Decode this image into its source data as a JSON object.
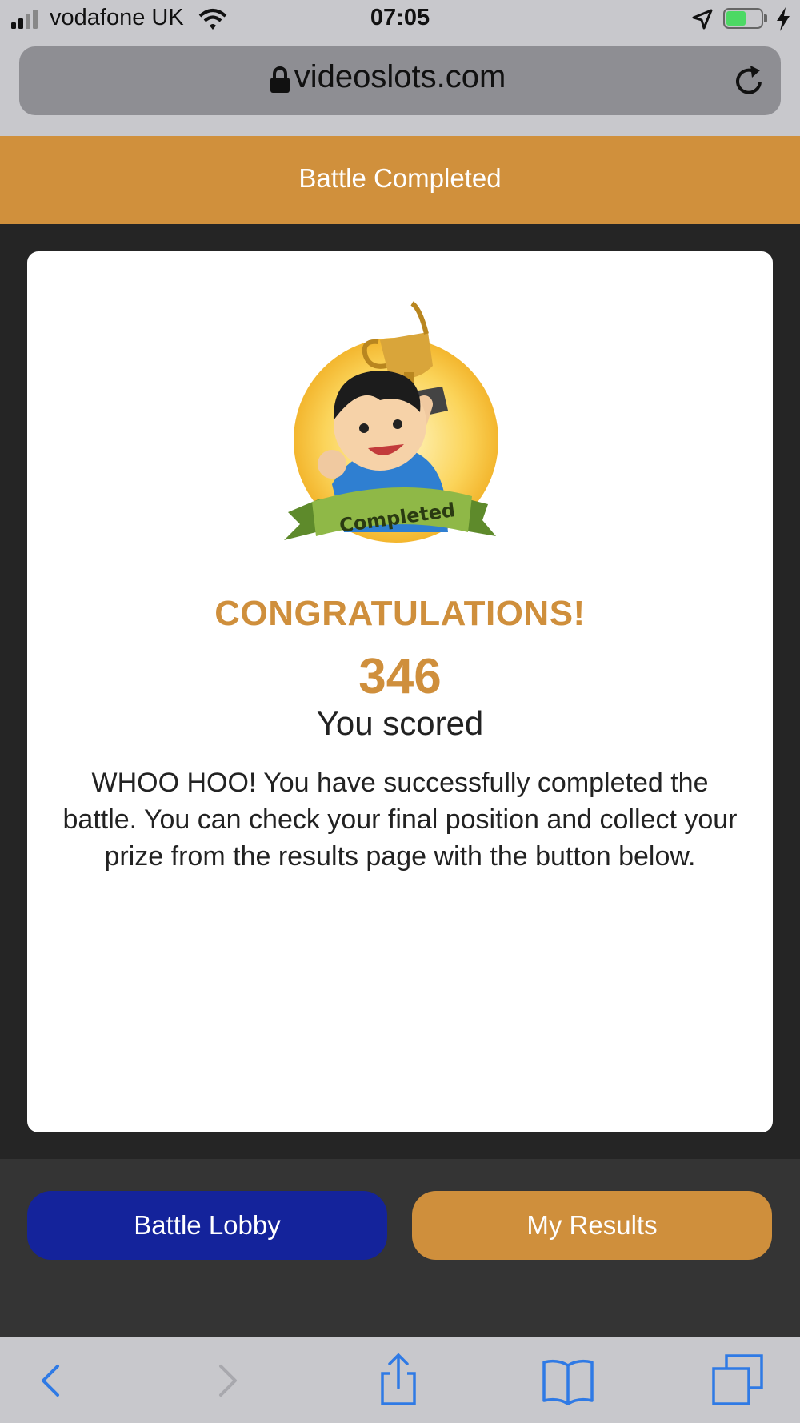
{
  "status_bar": {
    "carrier": "vodafone UK",
    "time": "07:05",
    "icons": [
      "signal-icon",
      "wifi-icon",
      "location-arrow-icon",
      "battery-icon",
      "charging-bolt-icon"
    ],
    "battery_color": "#4cd964"
  },
  "browser": {
    "url": "videoslots.com",
    "icons": [
      "lock-icon",
      "reload-icon"
    ]
  },
  "header": {
    "title": "Battle Completed"
  },
  "result": {
    "badge_text": "Completed",
    "heading": "CONGRATULATIONS!",
    "score": "346",
    "score_label": "You scored",
    "message": "WHOO HOO! You have successfully completed the battle. You can check your final position and collect your prize from the results page with the button below."
  },
  "buttons": {
    "lobby": "Battle Lobby",
    "results": "My Results"
  },
  "toolbar": {
    "icons": [
      "back-icon",
      "forward-icon",
      "share-icon",
      "bookmarks-icon",
      "tabs-icon"
    ]
  },
  "colors": {
    "accent": "#cf8f3c",
    "lobby_button": "#14239b",
    "background_dark": "#252525"
  }
}
